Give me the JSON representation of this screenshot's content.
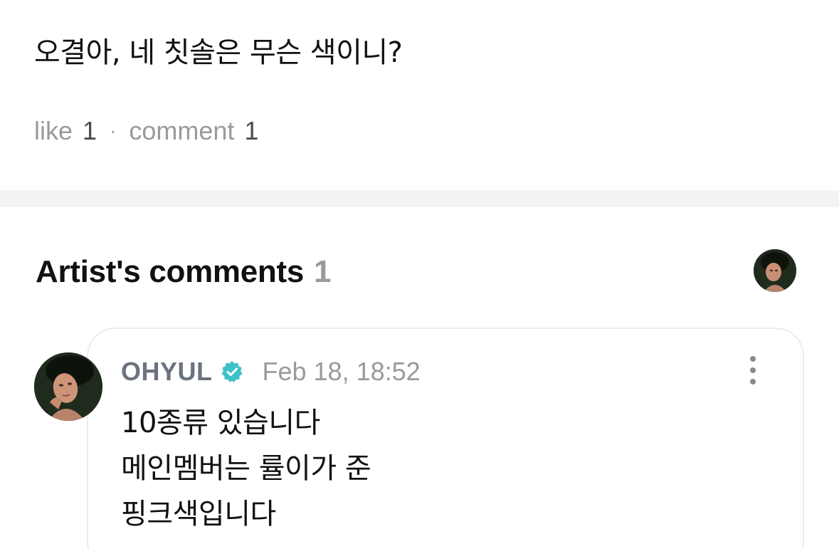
{
  "post": {
    "text": "오결아, 네 칫솔은 무슨 색이니?",
    "stats": {
      "like_label": "like",
      "like_count": "1",
      "separator": "·",
      "comment_label": "comment",
      "comment_count": "1"
    }
  },
  "artist_comments": {
    "title": "Artist's comments",
    "count": "1",
    "comments": [
      {
        "author": "OHYUL",
        "verified": true,
        "timestamp": "Feb 18, 18:52",
        "lines": [
          "10종류 있습니다",
          "메인멤버는 률이가 준",
          "핑크색입니다"
        ]
      }
    ]
  },
  "colors": {
    "verified_badge": "#3fc1c9",
    "divider": "#f3f3f3",
    "muted_text": "#9a9a9a",
    "author_text": "#6b7280"
  },
  "icons": {
    "verified": "verified-badge-icon",
    "more": "more-vertical-icon"
  }
}
